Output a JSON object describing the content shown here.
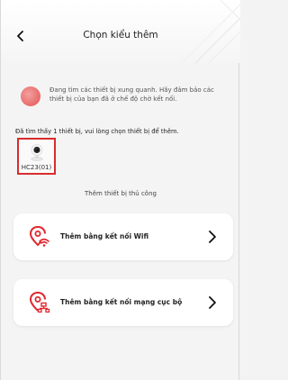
{
  "header": {
    "title": "Chọn kiểu thêm",
    "back_icon": "chevron-left-icon"
  },
  "scan": {
    "text": "Đang tìm các thiết bị xung quanh. Hãy đảm bảo các thiết bị của bạn đã ở chế độ chờ kết nối.",
    "found_text": "Đã tìm thấy 1 thiết bị, vui lòng chọn thiết bị để thêm."
  },
  "devices": [
    {
      "name": "HC23(01)",
      "icon": "camera-icon"
    }
  ],
  "manual": {
    "label": "Thêm thiết bị thủ công",
    "options": [
      {
        "label": "Thêm bằng kết nối Wifi",
        "icon": "wifi-location-icon"
      },
      {
        "label": "Thêm bằng kết nối mạng cục bộ",
        "icon": "lan-location-icon"
      }
    ]
  },
  "colors": {
    "accent": "#e0282e",
    "highlight_border": "#d92c2c",
    "background": "#f4f4f4"
  }
}
